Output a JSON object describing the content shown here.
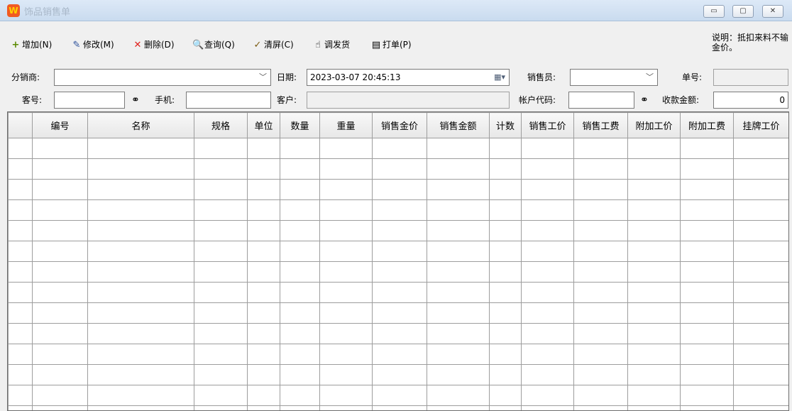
{
  "window": {
    "title": "饰品销售单",
    "app_icon": "W",
    "controls": {
      "minimize": "▭",
      "maximize": "▢",
      "close": "✕"
    }
  },
  "toolbar": {
    "add": "增加(N)",
    "edit": "修改(M)",
    "delete": "删除(D)",
    "query": "查询(Q)",
    "clear": "清屏(C)",
    "transfer": "调发货",
    "print": "打单(P)",
    "icons": {
      "add": "plus-icon",
      "edit": "edit-icon",
      "delete": "x-icon",
      "query": "search-icon",
      "clear": "broom-icon",
      "transfer": "hand-icon",
      "print": "printer-icon"
    },
    "accent_colors": {
      "add": "#5a8a00",
      "delete": "#e0201b"
    }
  },
  "note": "说明：抵扣来料不输金价。",
  "form": {
    "distributor_label": "分销商:",
    "distributor_value": "",
    "date_label": "日期:",
    "date_value": "2023-03-07 20:45:13",
    "salesperson_label": "销售员:",
    "salesperson_value": "",
    "order_no_label": "单号:",
    "order_no_value": "",
    "customer_no_label": "客号:",
    "customer_no_value": "",
    "phone_label": "手机:",
    "phone_value": "",
    "customer_label": "客户:",
    "customer_value": "",
    "account_code_label": "帐户代码:",
    "account_code_value": "",
    "amount_label": "收款金额:",
    "amount_value": "0"
  },
  "grid": {
    "columns": [
      "",
      "编号",
      "名称",
      "规格",
      "单位",
      "数量",
      "重量",
      "销售金价",
      "销售金额",
      "计数",
      "销售工价",
      "销售工费",
      "附加工价",
      "附加工费",
      "挂牌工价"
    ],
    "rows": [
      [
        "",
        "",
        "",
        "",
        "",
        "",
        "",
        "",
        "",
        "",
        "",
        "",
        "",
        "",
        ""
      ],
      [
        "",
        "",
        "",
        "",
        "",
        "",
        "",
        "",
        "",
        "",
        "",
        "",
        "",
        "",
        ""
      ],
      [
        "",
        "",
        "",
        "",
        "",
        "",
        "",
        "",
        "",
        "",
        "",
        "",
        "",
        "",
        ""
      ],
      [
        "",
        "",
        "",
        "",
        "",
        "",
        "",
        "",
        "",
        "",
        "",
        "",
        "",
        "",
        ""
      ],
      [
        "",
        "",
        "",
        "",
        "",
        "",
        "",
        "",
        "",
        "",
        "",
        "",
        "",
        "",
        ""
      ],
      [
        "",
        "",
        "",
        "",
        "",
        "",
        "",
        "",
        "",
        "",
        "",
        "",
        "",
        "",
        ""
      ],
      [
        "",
        "",
        "",
        "",
        "",
        "",
        "",
        "",
        "",
        "",
        "",
        "",
        "",
        "",
        ""
      ],
      [
        "",
        "",
        "",
        "",
        "",
        "",
        "",
        "",
        "",
        "",
        "",
        "",
        "",
        "",
        ""
      ],
      [
        "",
        "",
        "",
        "",
        "",
        "",
        "",
        "",
        "",
        "",
        "",
        "",
        "",
        "",
        ""
      ],
      [
        "",
        "",
        "",
        "",
        "",
        "",
        "",
        "",
        "",
        "",
        "",
        "",
        "",
        "",
        ""
      ],
      [
        "",
        "",
        "",
        "",
        "",
        "",
        "",
        "",
        "",
        "",
        "",
        "",
        "",
        "",
        ""
      ],
      [
        "",
        "",
        "",
        "",
        "",
        "",
        "",
        "",
        "",
        "",
        "",
        "",
        "",
        "",
        ""
      ],
      [
        "",
        "",
        "",
        "",
        "",
        "",
        "",
        "",
        "",
        "",
        "",
        "",
        "",
        "",
        ""
      ],
      [
        "",
        "",
        "",
        "",
        "",
        "",
        "",
        "",
        "",
        "",
        "",
        "",
        "",
        "",
        ""
      ]
    ]
  }
}
